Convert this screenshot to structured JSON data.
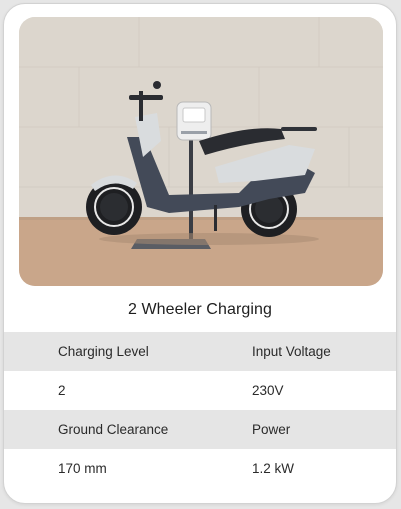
{
  "card": {
    "title": "2 Wheeler Charging"
  },
  "specs": [
    {
      "left": "Charging Level",
      "right": "Input Voltage",
      "shaded": true
    },
    {
      "left": "2",
      "right": "230V",
      "shaded": false
    },
    {
      "left": "Ground Clearance",
      "right": "Power",
      "shaded": true
    },
    {
      "left": "170 mm",
      "right": "1.2 kW",
      "shaded": false
    }
  ],
  "colors": {
    "wall": "#dcd6cd",
    "floor": "#c9a68a",
    "scooter_body": "#434a58",
    "scooter_panel": "#d9dcde",
    "row_shade": "#e5e5e5"
  }
}
